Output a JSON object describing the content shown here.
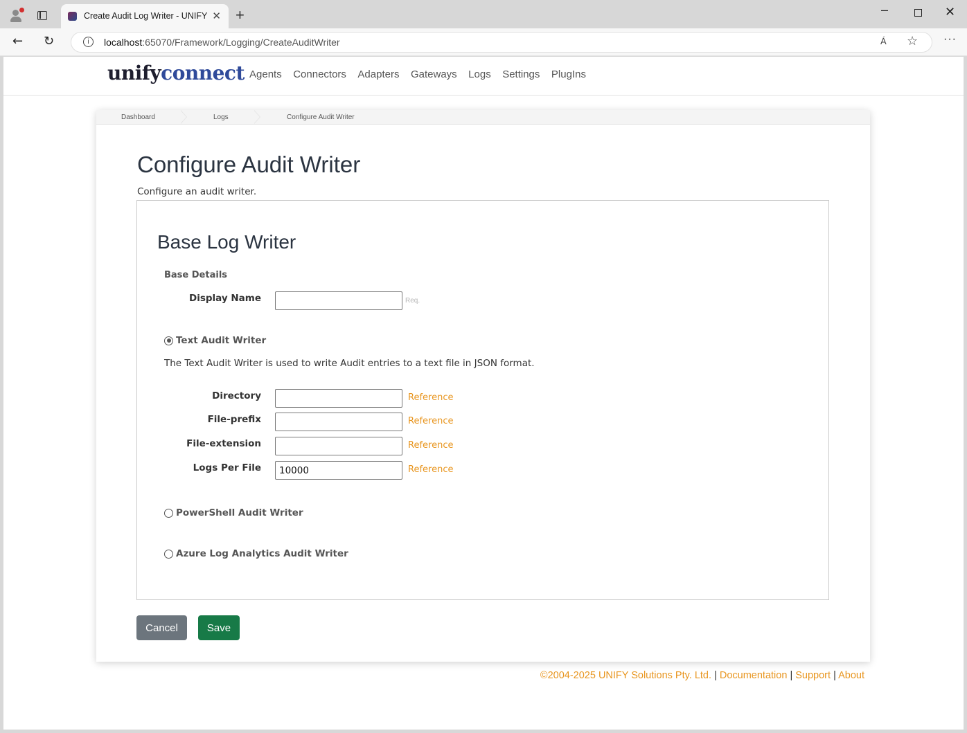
{
  "browser": {
    "tab_title": "Create Audit Log Writer - UNIFYConnect",
    "tab_close": "✕",
    "new_tab": "+",
    "url_host": "localhost",
    "url_rest": ":65070/Framework/Logging/CreateAuditWriter",
    "read_aloud": "Á",
    "more": "···"
  },
  "brand": {
    "part1": "unify",
    "part2": "connect"
  },
  "nav": [
    "Agents",
    "Connectors",
    "Adapters",
    "Gateways",
    "Logs",
    "Settings",
    "PlugIns"
  ],
  "breadcrumb": [
    "Dashboard",
    "Logs",
    "Configure Audit Writer"
  ],
  "page": {
    "title": "Configure Audit Writer",
    "subtitle": "Configure an audit writer."
  },
  "panel": {
    "title": "Base Log Writer",
    "section": "Base Details",
    "display_name_label": "Display Name",
    "display_name_value": "",
    "req": "Req.",
    "writers": [
      {
        "label": "Text Audit Writer",
        "selected": true
      },
      {
        "label": "PowerShell Audit Writer",
        "selected": false
      },
      {
        "label": "Azure Log Analytics Audit Writer",
        "selected": false
      }
    ],
    "text_writer_desc": "The Text Audit Writer is used to write Audit entries to a text file in JSON format.",
    "fields": [
      {
        "label": "Directory",
        "value": "",
        "ref": "Reference"
      },
      {
        "label": "File-prefix",
        "value": "",
        "ref": "Reference"
      },
      {
        "label": "File-extension",
        "value": "",
        "ref": "Reference"
      },
      {
        "label": "Logs Per File",
        "value": "10000",
        "ref": "Reference"
      }
    ]
  },
  "buttons": {
    "cancel": "Cancel",
    "save": "Save"
  },
  "footer": {
    "copyright": "©2004-2025 UNIFY Solutions Pty. Ltd.",
    "sep": "|",
    "documentation": "Documentation",
    "support": "Support",
    "about": "About"
  },
  "colors": {
    "accent_orange": "#e8951e",
    "save_green": "#177a47",
    "cancel_gray": "#6c757d",
    "brand_blue": "#2f4a9a"
  }
}
